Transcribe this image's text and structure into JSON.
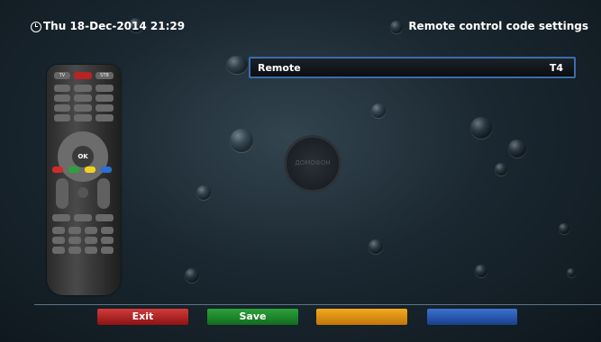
{
  "header": {
    "datetime": "Thu 18-Dec-2014 21:29",
    "title": "Remote control code settings"
  },
  "settings": {
    "rows": [
      {
        "label": "Remote",
        "value": "T4"
      }
    ]
  },
  "remote_image": {
    "top_buttons": [
      "TV",
      "",
      "STB"
    ],
    "nav_center": "OK",
    "color_keys": [
      "#d32a2a",
      "#2ca23a",
      "#f2d21e",
      "#2b6fd6"
    ]
  },
  "center_logo": {
    "text": "ДОМОФОН"
  },
  "footer": {
    "buttons": [
      {
        "label": "Exit",
        "color": "#c12424"
      },
      {
        "label": "Save",
        "color": "#1e8a2a"
      },
      {
        "label": "",
        "color": "#e38f13"
      },
      {
        "label": "",
        "color": "#2c5fb5"
      }
    ]
  }
}
